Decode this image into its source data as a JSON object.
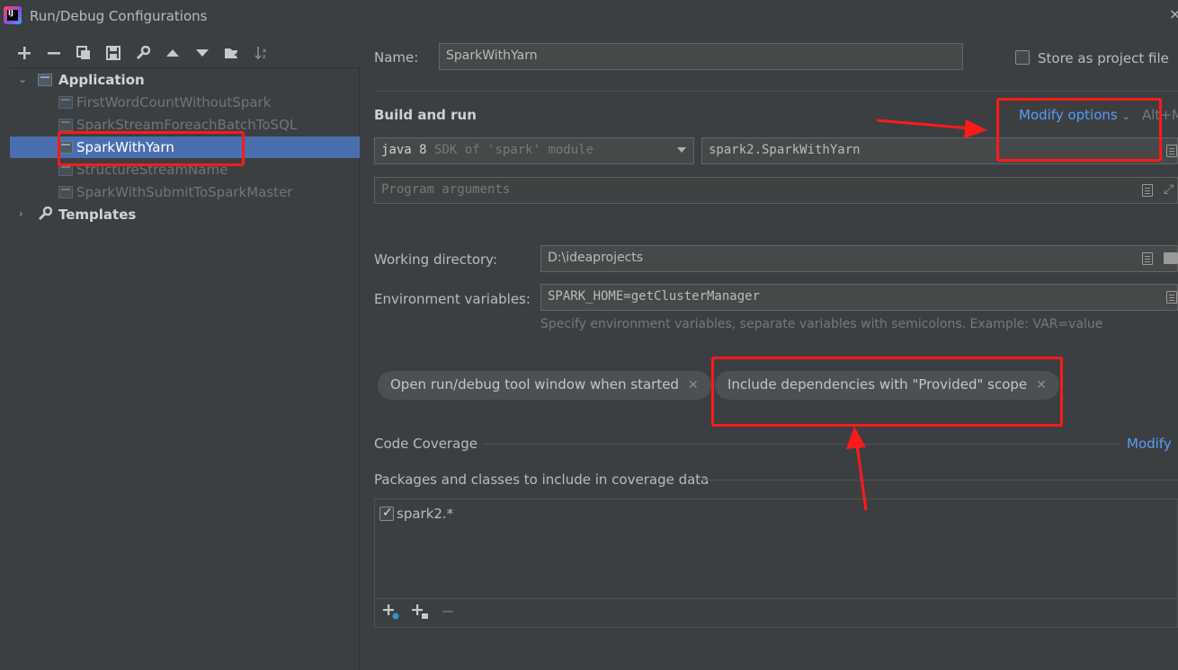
{
  "window": {
    "title": "Run/Debug Configurations",
    "close": "×"
  },
  "toolbar": {
    "items": [
      {
        "name": "add-icon",
        "glyph": "+"
      },
      {
        "name": "remove-icon",
        "glyph": "−"
      },
      {
        "name": "copy-icon",
        "glyph": ""
      },
      {
        "name": "save-icon",
        "glyph": ""
      },
      {
        "name": "wrench-icon",
        "glyph": ""
      },
      {
        "name": "move-up-icon",
        "glyph": ""
      },
      {
        "name": "move-down-icon",
        "glyph": ""
      },
      {
        "name": "new-folder-icon",
        "glyph": ""
      },
      {
        "name": "sort-icon",
        "glyph": ""
      }
    ]
  },
  "tree": {
    "application_label": "Application",
    "templates_label": "Templates",
    "items": [
      {
        "label": "FirstWordCountWithoutSpark",
        "selected": false
      },
      {
        "label": "SparkStreamForeachBatchToSQL",
        "selected": false
      },
      {
        "label": "SparkWithYarn",
        "selected": true
      },
      {
        "label": "StructureStreamName",
        "selected": false
      },
      {
        "label": "SparkWithSubmitToSparkMaster",
        "selected": false
      }
    ]
  },
  "form": {
    "name_label": "Name:",
    "name_value": "SparkWithYarn",
    "store_label": "Store as project file",
    "build_run_label": "Build and run",
    "modify_options": "Modify options",
    "modify_shortcut": "Alt+M",
    "sdk_main": "java 8",
    "sdk_hint": "SDK of 'spark' module",
    "main_class": "spark2.SparkWithYarn",
    "program_args_placeholder": "Program arguments",
    "working_dir_label": "Working directory:",
    "working_dir_value": "D:\\ideaprojects",
    "env_label": "Environment variables:",
    "env_value": "SPARK_HOME=getClusterManager",
    "env_hint": "Specify environment variables, separate variables with semicolons. Example: VAR=value",
    "chips": [
      "Open run/debug tool window when started",
      "Include dependencies with \"Provided\" scope"
    ],
    "code_coverage_label": "Code Coverage",
    "coverage_modify": "Modify",
    "packages_label": "Packages and classes to include in coverage data",
    "coverage_items": [
      {
        "label": "spark2.*",
        "checked": true
      }
    ]
  },
  "colors": {
    "background": "#3c3f41",
    "selection": "#4b6eaf",
    "link": "#589df6",
    "annotation": "#ff1a1a"
  }
}
